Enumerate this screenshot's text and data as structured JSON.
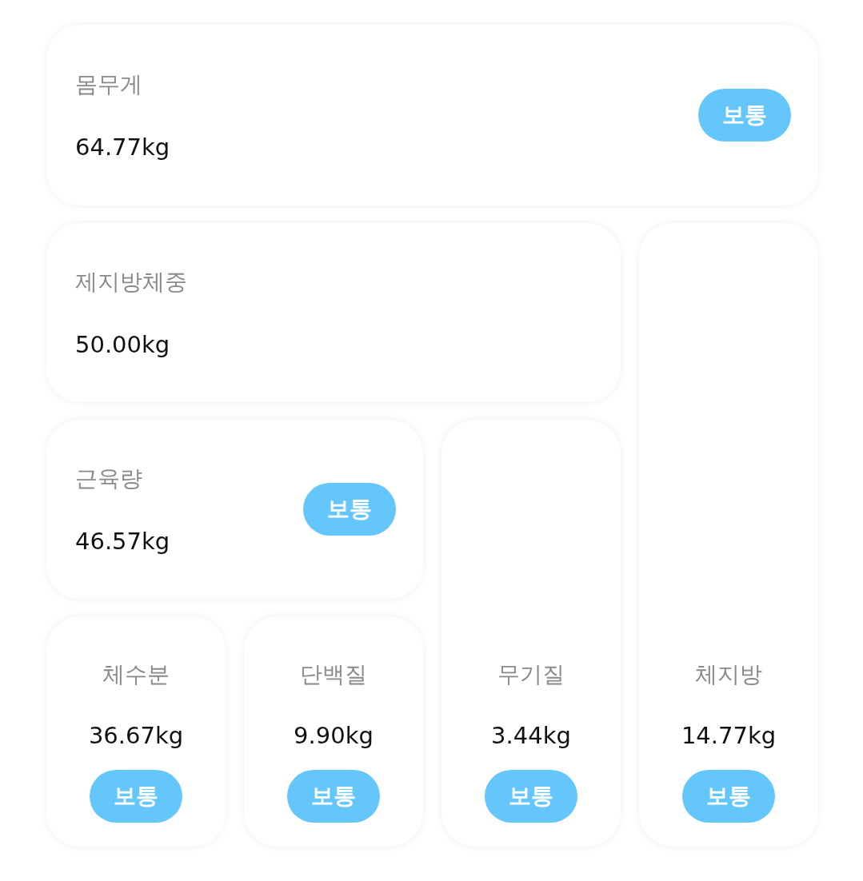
{
  "cards": [
    {
      "kind": "row",
      "label": "몸무게",
      "value": "64.77kg",
      "badge": "보통"
    },
    {
      "kind": "row",
      "label": "제지방체중",
      "value": "50.00kg"
    },
    {
      "kind": "row",
      "label": "근육량",
      "value": "46.57kg",
      "badge": "보통"
    },
    {
      "kind": "column",
      "label": "체수분",
      "value": "36.67kg",
      "badge": "보통"
    },
    {
      "kind": "column",
      "label": "단백질",
      "value": "9.90kg",
      "badge": "보통"
    },
    {
      "kind": "column",
      "label": "무기질",
      "value": "3.44kg",
      "badge": "보통"
    },
    {
      "kind": "column",
      "label": "체지방",
      "value": "14.77kg",
      "badge": "보통"
    }
  ]
}
